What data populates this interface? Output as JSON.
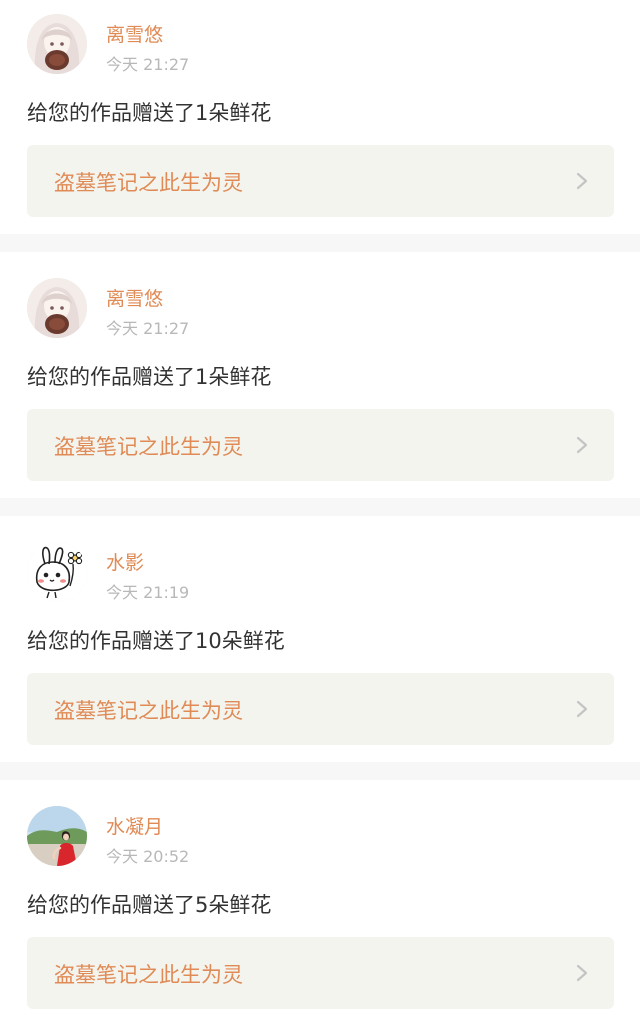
{
  "notifications": [
    {
      "username": "离雪悠",
      "time": "今天 21:27",
      "message": "给您的作品赠送了1朵鲜花",
      "work_title": "盗墓笔记之此生为灵",
      "avatar_icon": "anime-girl-avatar"
    },
    {
      "username": "离雪悠",
      "time": "今天 21:27",
      "message": "给您的作品赠送了1朵鲜花",
      "work_title": "盗墓笔记之此生为灵",
      "avatar_icon": "anime-girl-avatar"
    },
    {
      "username": "水影",
      "time": "今天 21:19",
      "message": "给您的作品赠送了10朵鲜花",
      "work_title": "盗墓笔记之此生为灵",
      "avatar_icon": "cartoon-rabbit-avatar"
    },
    {
      "username": "水凝月",
      "time": "今天 20:52",
      "message": "给您的作品赠送了5朵鲜花",
      "work_title": "盗墓笔记之此生为灵",
      "avatar_icon": "photo-red-dress-avatar"
    }
  ],
  "colors": {
    "accent": "#e08a55",
    "muted": "#b8b8b8",
    "text": "#333333",
    "link_bg": "#f4f4ef",
    "page_bg": "#f7f7f7"
  }
}
